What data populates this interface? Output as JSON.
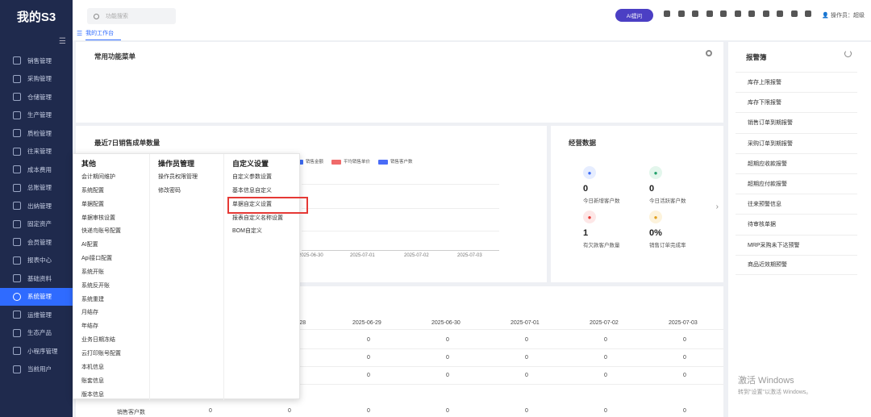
{
  "app": {
    "logo": "我的S3"
  },
  "sidebar": {
    "items": [
      {
        "label": "销售管理",
        "icon": "sales-icon"
      },
      {
        "label": "采购管理",
        "icon": "cart-icon"
      },
      {
        "label": "仓储管理",
        "icon": "warehouse-icon"
      },
      {
        "label": "生产管理",
        "icon": "factory-icon"
      },
      {
        "label": "质检管理",
        "icon": "shield-icon"
      },
      {
        "label": "往来管理",
        "icon": "exchange-icon"
      },
      {
        "label": "成本费用",
        "icon": "cost-icon"
      },
      {
        "label": "总账管理",
        "icon": "ledger-icon"
      },
      {
        "label": "出纳管理",
        "icon": "cashier-icon"
      },
      {
        "label": "固定资产",
        "icon": "asset-icon"
      },
      {
        "label": "会员管理",
        "icon": "member-icon"
      },
      {
        "label": "报表中心",
        "icon": "report-icon"
      },
      {
        "label": "基础资料",
        "icon": "book-icon"
      },
      {
        "label": "系统管理",
        "icon": "gear-icon",
        "active": true
      },
      {
        "label": "运维管理",
        "icon": "monitor-icon"
      },
      {
        "label": "生态产品",
        "icon": "product-icon"
      },
      {
        "label": "小程序管理",
        "icon": "miniapp-icon"
      },
      {
        "label": "当前用户",
        "icon": "user-icon"
      }
    ]
  },
  "header": {
    "search_placeholder": "功能搜索",
    "ai_label": "AI提问",
    "operator": "操作员：超级",
    "icons": [
      "message-icon",
      "shield-icon",
      "chat-icon",
      "help-icon",
      "notification-icon",
      "home-icon",
      "question-icon",
      "info-icon",
      "grid-icon",
      "theme-icon",
      "user-icon"
    ]
  },
  "tabs": [
    {
      "label": "我的工作台",
      "active": true
    }
  ],
  "common_functions": {
    "title": "常用功能菜单"
  },
  "sales_chart": {
    "title": "最近7日销售成单数量",
    "legend": [
      {
        "label": "销售金额",
        "color": "#3d6cf5"
      },
      {
        "label": "平均销售单价",
        "color": "#f06a6a"
      },
      {
        "label": "销售客户数",
        "color": "#4a6cf7"
      }
    ],
    "xticks": [
      "2025-06-30",
      "2025-07-01",
      "2025-07-02",
      "2025-07-03"
    ]
  },
  "business": {
    "title": "经营数据",
    "items": [
      {
        "value": "0",
        "label": "今日新增客户数",
        "icon": "person-icon",
        "color": "#3d6cf5",
        "bg": "#e6edff"
      },
      {
        "value": "0",
        "label": "今日活跃客户数",
        "icon": "activity-icon",
        "color": "#22a06b",
        "bg": "#e3f6ec"
      },
      {
        "value": "1",
        "label": "有欠款客户数量",
        "icon": "heart-icon",
        "color": "#e53935",
        "bg": "#fde7e7"
      },
      {
        "value": "0%",
        "label": "销售订单完成率",
        "icon": "smile-icon",
        "color": "#e0a020",
        "bg": "#fdf3dc"
      }
    ]
  },
  "table": {
    "columns": [
      "-28",
      "2025-06-29",
      "2025-06-30",
      "2025-07-01",
      "2025-07-02",
      "2025-07-03"
    ],
    "rows": [
      [
        "0",
        "0",
        "0",
        "0",
        "0"
      ],
      [
        "0",
        "0",
        "0",
        "0",
        "0"
      ],
      [
        "0",
        "0",
        "0",
        "0",
        "0"
      ]
    ],
    "last_row": {
      "label": "销售客户数",
      "values": [
        "0",
        "0",
        "0",
        "0",
        "0",
        "0",
        "0"
      ]
    }
  },
  "alarm": {
    "title": "报警簿",
    "items": [
      "库存上限报警",
      "库存下限报警",
      "销售订单到期报警",
      "采购订单到期报警",
      "超期应收款报警",
      "超期应付款报警",
      "往来预警信息",
      "待审核单据",
      "MRP采购未下达预警",
      "商品近效期预警"
    ]
  },
  "watermark": {
    "line1": "激活 Windows",
    "line2": "转到\"设置\"以激活 Windows。"
  },
  "dropdown": {
    "columns": [
      {
        "title": "其他",
        "items": [
          "会计期间维护",
          "系统配置",
          "单据配置",
          "单据审核设置",
          "快递鸟账号配置",
          "AI配置",
          "Api接口配置",
          "系统开账",
          "系统反开账",
          "系统重建",
          "月结存",
          "年结存",
          "业务日期冻结",
          "云打印账号配置",
          "本机信息",
          "账套信息",
          "版本信息"
        ]
      },
      {
        "title": "操作员管理",
        "items": [
          "操作员权限管理",
          "修改密码"
        ]
      },
      {
        "title": "自定义设置",
        "items": [
          "自定义参数设置",
          "基本信息自定义",
          "单据自定义设置",
          "报表自定义名称设置",
          "BOM自定义"
        ],
        "highlighted": 2
      }
    ]
  }
}
